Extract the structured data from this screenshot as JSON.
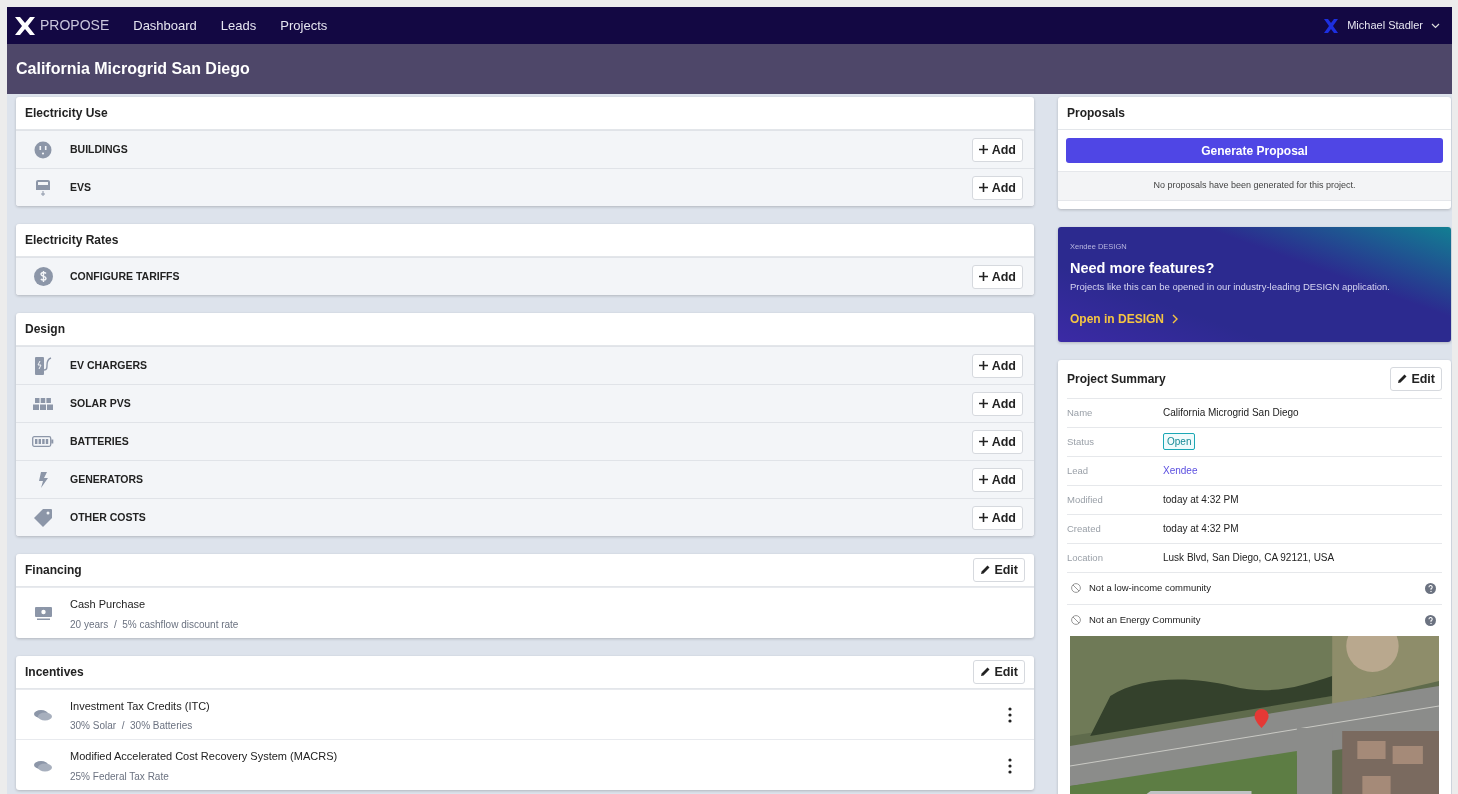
{
  "navbar": {
    "brand": "PROPOSE",
    "links": [
      {
        "label": "Dashboard",
        "selected": false
      },
      {
        "label": "Leads",
        "selected": false
      },
      {
        "label": "Projects",
        "selected": false
      }
    ],
    "user": "Michael Stadler"
  },
  "page_title": "California Microgrid San Diego",
  "sections": [
    {
      "title": "Electricity Use",
      "rows": [
        {
          "kind": "add",
          "label": "BUILDINGS",
          "button": "Add"
        },
        {
          "kind": "add",
          "label": "EVS",
          "button": "Add"
        }
      ]
    },
    {
      "title": "Electricity Rates",
      "rows": [
        {
          "kind": "add",
          "label": "CONFIGURE TARIFFS",
          "button": "Add"
        }
      ]
    },
    {
      "title": "Design",
      "rows": [
        {
          "kind": "add",
          "label": "EV CHARGERS",
          "button": "Add"
        },
        {
          "kind": "add",
          "label": "SOLAR PVS",
          "button": "Add"
        },
        {
          "kind": "add",
          "label": "BATTERIES",
          "button": "Add"
        },
        {
          "kind": "add",
          "label": "GENERATORS",
          "button": "Add"
        },
        {
          "kind": "add",
          "label": "OTHER COSTS",
          "button": "Add"
        }
      ]
    },
    {
      "title": "Financing",
      "button": "Edit",
      "rows": [
        {
          "kind": "detail",
          "label": "Cash Purchase",
          "subtitle": "20 years  /  5% cashflow discount rate",
          "menu": false
        }
      ]
    },
    {
      "title": "Incentives",
      "button": "Edit",
      "rows": [
        {
          "kind": "detail",
          "label": "Investment Tax Credits (ITC)",
          "subtitle": "30% Solar  /  30% Batteries",
          "menu": true
        },
        {
          "kind": "detail",
          "label": "Modified Accelerated Cost Recovery System (MACRS)",
          "subtitle": "25% Federal Tax Rate",
          "menu": true
        }
      ]
    }
  ],
  "proposals": {
    "title": "Proposals",
    "button": "Generate Proposal",
    "empty_note": "No proposals have been generated for this project."
  },
  "promo": {
    "eyebrow": "Xendee DESIGN",
    "title": "Need more features?",
    "text": "Projects like this can be opened in our industry-leading DESIGN application.",
    "link": "Open in DESIGN"
  },
  "summary": {
    "title": "Project Summary",
    "button": "Edit",
    "fields": [
      {
        "kind": "text",
        "label": "Name",
        "value": "California Microgrid San Diego"
      },
      {
        "kind": "badge",
        "label": "Status",
        "value": "Open"
      },
      {
        "kind": "link",
        "label": "Lead",
        "value": "Xendee"
      },
      {
        "kind": "text",
        "label": "Modified",
        "value": "today at 4:32 PM"
      },
      {
        "kind": "text",
        "label": "Created",
        "value": "today at 4:32 PM"
      },
      {
        "kind": "text",
        "label": "Location",
        "value": "Lusk Blvd, San Diego, CA 92121, USA"
      }
    ],
    "flags": [
      "Not a low-income community",
      "Not an Energy Community"
    ],
    "map": {
      "kind": "picture"
    }
  }
}
